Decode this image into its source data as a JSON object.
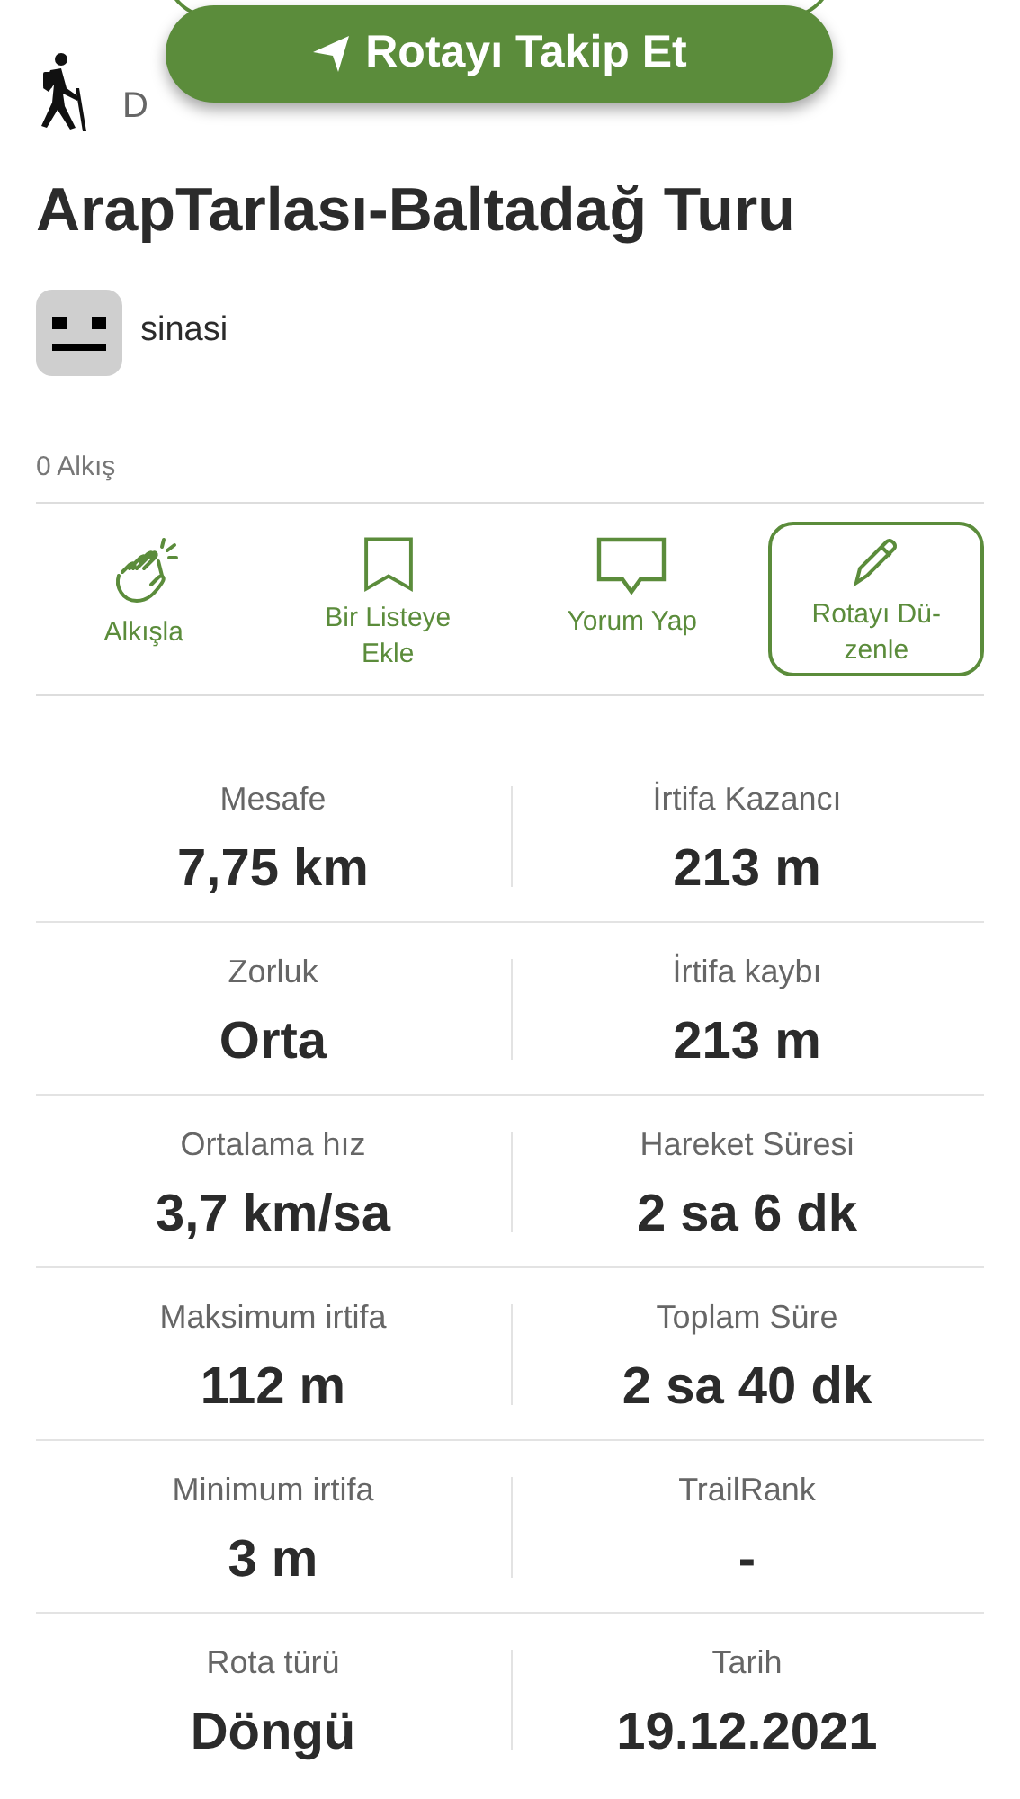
{
  "follow_button": {
    "label": "Rotayı Takip Et"
  },
  "activity": {
    "label": "D"
  },
  "title": "ArapTarlası-Baltadağ Turu",
  "author": {
    "name": "sinasi"
  },
  "applause_count": "0 Alkış",
  "actions": [
    {
      "kind": "clap",
      "label": "Alkışla",
      "selected": false
    },
    {
      "kind": "bookmark",
      "label": "Bir Listeye Ekle",
      "selected": false
    },
    {
      "kind": "comment",
      "label": "Yorum Yap",
      "selected": false
    },
    {
      "kind": "edit",
      "label": "Rotayı Dü-zenle",
      "selected": true
    }
  ],
  "stats": [
    {
      "label": "Mesafe",
      "value": "7,75 km"
    },
    {
      "label": "İrtifa Kazancı",
      "value": "213 m"
    },
    {
      "label": "Zorluk",
      "value": "Orta"
    },
    {
      "label": "İrtifa kaybı",
      "value": "213 m"
    },
    {
      "label": "Ortalama hız",
      "value": "3,7 km/sa"
    },
    {
      "label": "Hareket Süresi",
      "value": "2 sa 6 dk"
    },
    {
      "label": "Maksimum irtifa",
      "value": "112 m"
    },
    {
      "label": "Toplam Süre",
      "value": "2 sa 40 dk"
    },
    {
      "label": "Minimum irtifa",
      "value": "3 m"
    },
    {
      "label": "TrailRank",
      "value": "-"
    },
    {
      "label": "Rota türü",
      "value": "Döngü"
    },
    {
      "label": "Tarih",
      "value": "19.12.2021"
    }
  ]
}
